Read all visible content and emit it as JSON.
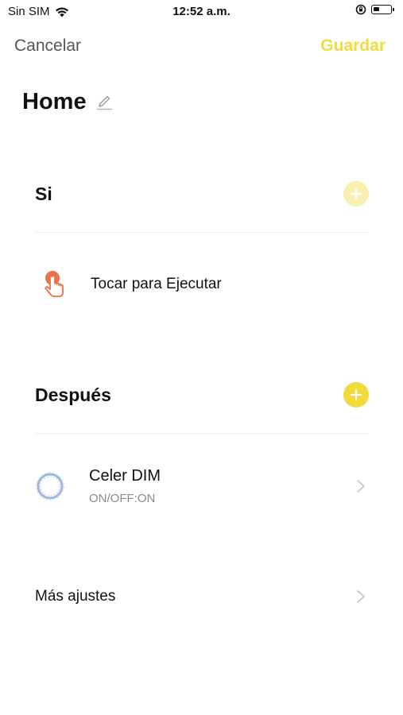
{
  "status_bar": {
    "carrier": "Sin SIM",
    "time": "12:52 a.m.",
    "battery_level": 0.35
  },
  "nav": {
    "cancel_label": "Cancelar",
    "save_label": "Guardar"
  },
  "scene": {
    "title": "Home"
  },
  "if_section": {
    "title": "Si",
    "add_icon": "plus-circle-icon",
    "conditions": [
      {
        "label": "Tocar para Ejecutar",
        "icon": "tap-hand-icon"
      }
    ]
  },
  "then_section": {
    "title": "Después",
    "add_icon": "plus-circle-icon",
    "actions": [
      {
        "title": "Celer DIM",
        "subtitle": "ON/OFF:ON",
        "icon": "device-ring-icon"
      }
    ]
  },
  "more_settings": {
    "label": "Más ajustes"
  },
  "colors": {
    "accent_yellow": "#f0dc3a",
    "accent_yellow_faded": "#f8f0b0",
    "tap_icon_orange": "#e8734a",
    "device_ring_blue": "#9fb8d8",
    "divider": "#ececec",
    "secondary_text": "#8a8a8a"
  }
}
